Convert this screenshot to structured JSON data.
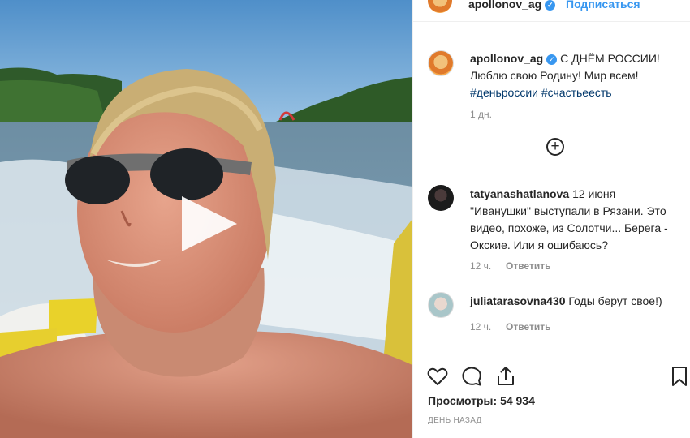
{
  "post": {
    "username": "apollonov_ag",
    "follow_label": "Подписаться",
    "caption_line1": "С ДНЁМ РОССИИ!",
    "caption_line2": "Люблю свою Родину! Мир всем!",
    "hashtag1": "#деньроссии",
    "hashtag2": "#счастьеесть",
    "caption_time": "1 дн."
  },
  "comments": [
    {
      "username": "tatyanashatlanova",
      "date": "12 июня",
      "line1": "\"Иванушки\" выступали в Рязани. Это",
      "line2": "видео, похоже, из Солотчи... Берега -",
      "line3": "Окские. Или я ошибаюсь?",
      "time": "12 ч.",
      "reply_label": "Ответить"
    },
    {
      "username": "juliatarasovna430",
      "text": "Годы берут свое!)",
      "time": "12 ч.",
      "reply_label": "Ответить"
    }
  ],
  "footer": {
    "views_label": "Просмотры:",
    "views_count": "54 934",
    "posted_ago": "ДЕНЬ НАЗАД"
  },
  "icons": [
    "play-icon",
    "load-more-icon",
    "like-icon",
    "comment-icon",
    "share-icon",
    "save-icon",
    "verified-icon"
  ],
  "colors": {
    "link": "#00376b",
    "follow": "#3897f0",
    "muted": "#8e8e8e"
  }
}
